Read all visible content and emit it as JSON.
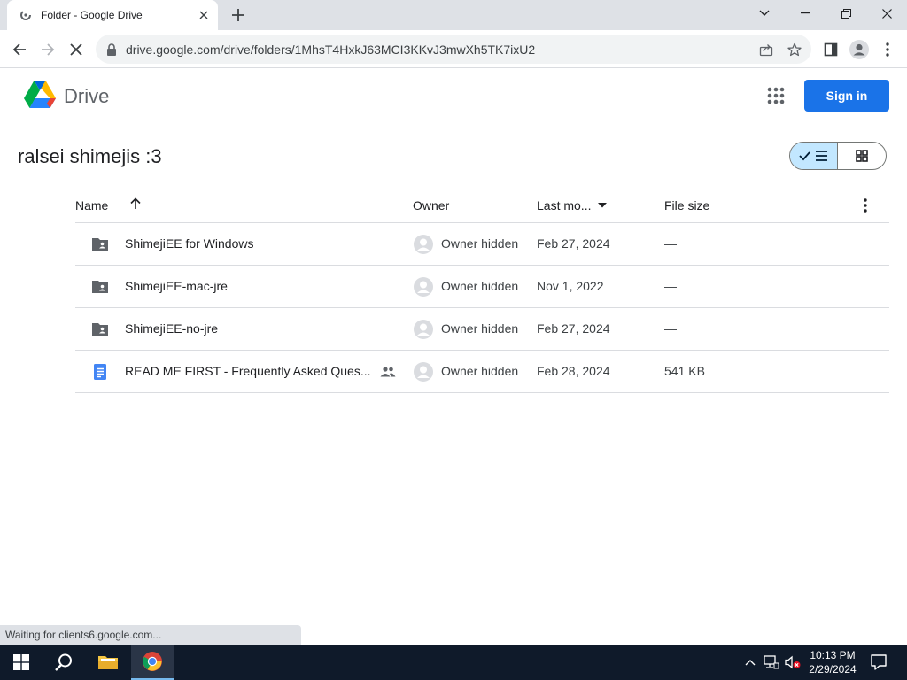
{
  "browser": {
    "tab_title": "Folder - Google Drive",
    "url": "drive.google.com/drive/folders/1MhsT4HxkJ63MCI3KKvJ3mwXh5TK7ixU2"
  },
  "header": {
    "app_name": "Drive",
    "signin_label": "Sign in"
  },
  "folder": {
    "title": "ralsei shimejis :3"
  },
  "table": {
    "columns": {
      "name": "Name",
      "owner": "Owner",
      "modified": "Last mo...",
      "size": "File size"
    },
    "rows": [
      {
        "type": "folder",
        "name": "ShimejiEE for Windows",
        "owner": "Owner hidden",
        "date": "Feb 27, 2024",
        "size": "—"
      },
      {
        "type": "folder",
        "name": "ShimejiEE-mac-jre",
        "owner": "Owner hidden",
        "date": "Nov 1, 2022",
        "size": "—"
      },
      {
        "type": "folder",
        "name": "ShimejiEE-no-jre",
        "owner": "Owner hidden",
        "date": "Feb 27, 2024",
        "size": "—"
      },
      {
        "type": "doc",
        "name": "READ ME FIRST - Frequently Asked Ques...",
        "owner": "Owner hidden",
        "date": "Feb 28, 2024",
        "size": "541 KB",
        "shared": true
      }
    ]
  },
  "status_bar": {
    "text": "Waiting for clients6.google.com..."
  },
  "taskbar": {
    "time": "10:13 PM",
    "date": "2/29/2024"
  },
  "colors": {
    "accent": "#1a73e8",
    "toggle_selected": "#c2e7ff",
    "taskbar": "#0f1a2a"
  }
}
